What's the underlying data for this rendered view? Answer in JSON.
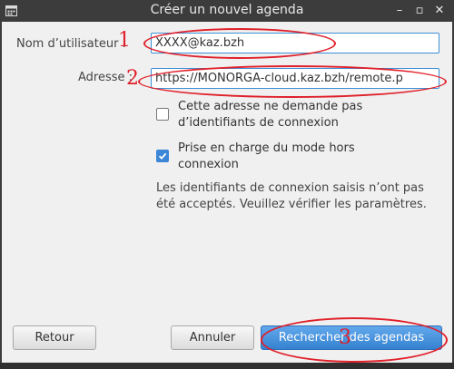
{
  "window": {
    "title": "Créer un nouvel agenda",
    "min_glyph": "–",
    "max_glyph": "▫",
    "close_glyph": "✕"
  },
  "form": {
    "username_label": "Nom d’utilisateur :",
    "username_value": "XXXX@kaz.bzh",
    "address_label": "Adresse :",
    "address_value": "https://MONORGA-cloud.kaz.bzh/remote.p",
    "no_credentials_label": "Cette adresse ne demande pas d’identifiants de connexion",
    "no_credentials_checked": false,
    "offline_label": "Prise en charge du mode hors connexion",
    "offline_checked": true,
    "error_message": "Les identifiants de connexion saisis n’ont pas été acceptés. Veuillez vérifier les paramètres."
  },
  "buttons": {
    "back_label": "Retour",
    "cancel_label": "Annuler",
    "search_label": "Rechercher des agendas"
  },
  "annotations": [
    "1",
    "2",
    "3"
  ],
  "colors": {
    "accent": "#3b86d6",
    "annotation": "#e0202a",
    "titlebar": "#3c3c3c"
  }
}
